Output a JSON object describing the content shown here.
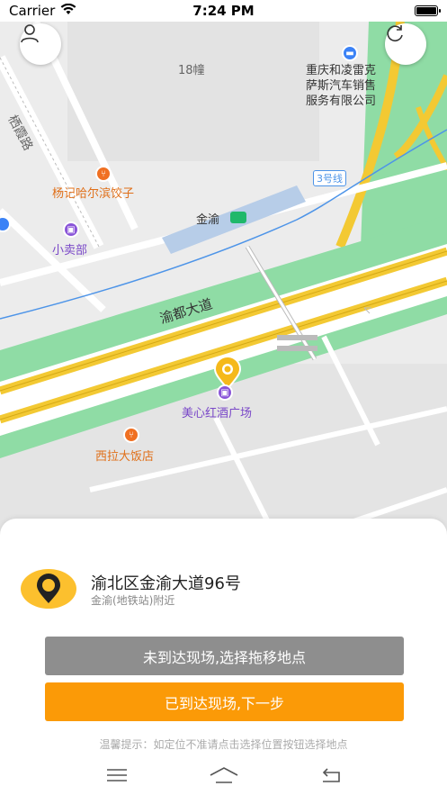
{
  "status_bar": {
    "carrier": "Carrier",
    "time": "7:24 PM"
  },
  "map": {
    "labels": {
      "building": "18幢",
      "company_lines": [
        "重庆和凌雷克",
        "萨斯汽车销售",
        "服务有限公司"
      ],
      "street_west": "栖霞路",
      "metro_line": "3号线",
      "restaurant1": "杨记哈尔滨饺子",
      "station": "金渝",
      "shop": "小卖部",
      "avenue": "渝都大道",
      "plaza": "美心红酒广场",
      "restaurant2": "西拉大饭店"
    }
  },
  "location": {
    "title": "渝北区金渝大道96号",
    "subtitle": "金渝(地铁站)附近"
  },
  "buttons": {
    "not_arrived": "未到达现场,选择拖移地点",
    "arrived": "已到达现场,下一步"
  },
  "tip": "温馨提示：如定位不准请点击选择位置按钮选择地点",
  "colors": {
    "accent": "#fb9a07",
    "secondary_button": "#8e8e8e",
    "road": "#f3c933",
    "green": "#8fdca5"
  }
}
